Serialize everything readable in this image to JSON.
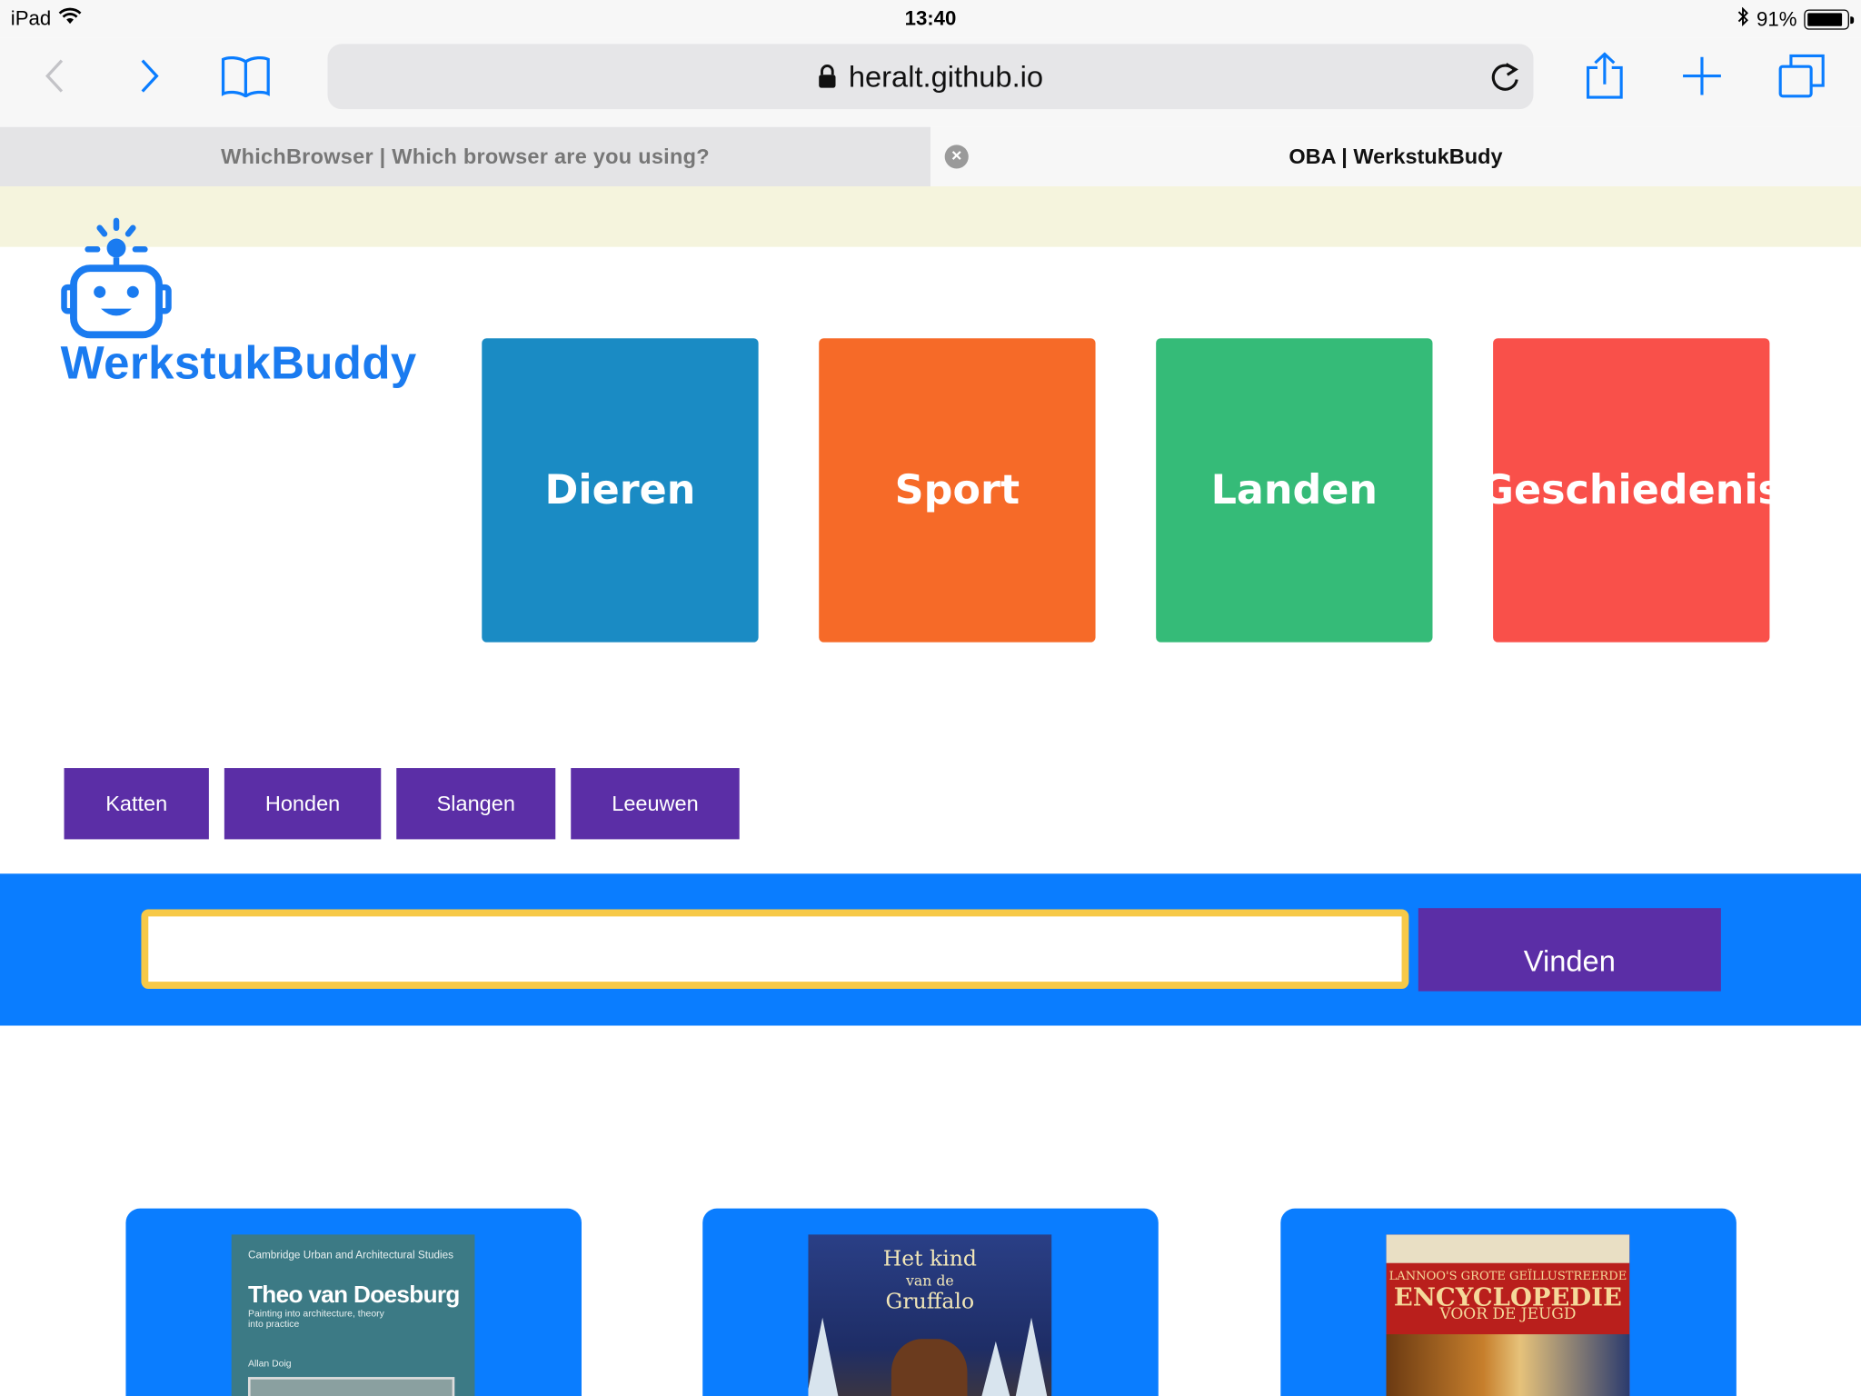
{
  "status_bar": {
    "device": "iPad",
    "time": "13:40",
    "battery": "91%",
    "battery_level": 0.91
  },
  "browser": {
    "url": "heralt.github.io",
    "tabs": [
      {
        "title": "WhichBrowser | Which browser are you using?",
        "active": false
      },
      {
        "title": "OBA | WerkstukBudy",
        "active": true
      }
    ],
    "tab_close_glyph": "×",
    "icons": [
      "back-icon",
      "forward-icon",
      "bookmarks-icon",
      "lock-icon",
      "reload-icon",
      "share-icon",
      "new-tab-icon",
      "tabs-icon"
    ]
  },
  "logo": {
    "name": "WerkstukBuddy",
    "color": "#1a7bf0"
  },
  "categories": [
    {
      "label": "Dieren",
      "color": "#1a8bc4"
    },
    {
      "label": "Sport",
      "color": "#f66a28"
    },
    {
      "label": "Landen",
      "color": "#35bb78"
    },
    {
      "label": "Geschiedenis",
      "color": "#f9504a"
    }
  ],
  "subtopics": [
    "Katten",
    "Honden",
    "Slangen",
    "Leeuwen"
  ],
  "search": {
    "value": "",
    "placeholder": "",
    "button_label": "Vinden"
  },
  "books": [
    {
      "series": "Cambridge Urban and Architectural Studies",
      "title": "Theo van Doesburg",
      "subtitle": "Painting into architecture, theory into practice",
      "author": "Allan Doig"
    },
    {
      "title_line1": "Het kind",
      "title_line2": "van de",
      "title_line3": "Gruffalo"
    },
    {
      "publisher": "LANNOO'S GROTE GEÏLLUSTREERDE",
      "title": "ENCYCLOPEDIE",
      "subtitle": "VOOR DE JEUGD"
    }
  ],
  "colors": {
    "accent_blue": "#0a7dff",
    "button_purple": "#5b2ea6",
    "input_border": "#f7c948",
    "banner": "#f5f4dd"
  }
}
